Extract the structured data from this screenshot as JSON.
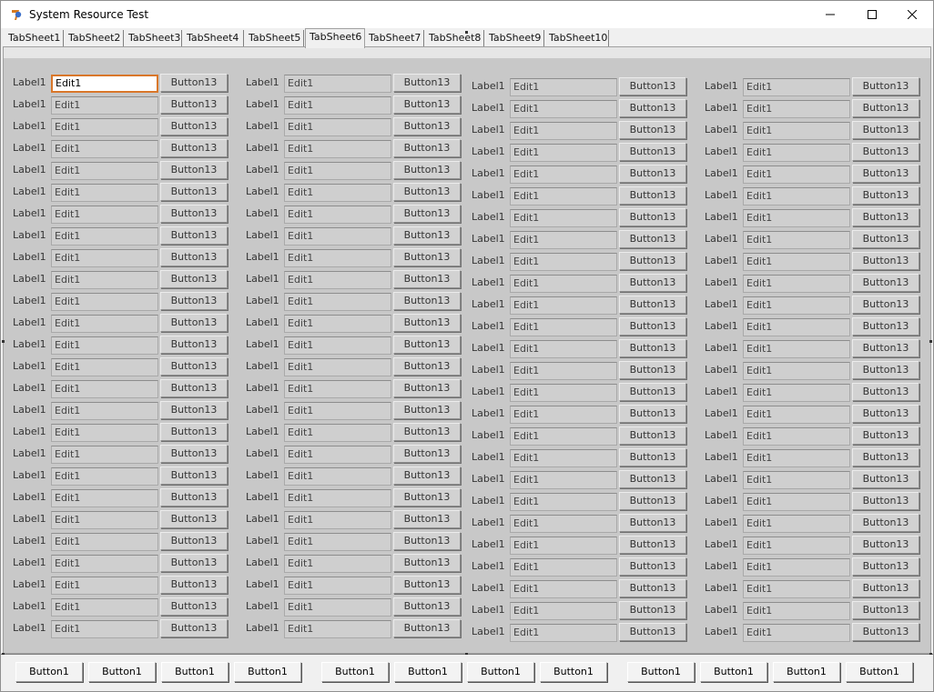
{
  "window": {
    "title": "System Resource Test",
    "icon": "delphi-app-icon"
  },
  "tabs": [
    "TabSheet1",
    "TabSheet2",
    "TabSheet3",
    "TabSheet4",
    "TabSheet5",
    "TabSheet6",
    "TabSheet7",
    "TabSheet8",
    "TabSheet9",
    "TabSheet10"
  ],
  "active_tab": "TabSheet6",
  "row_label": "Label1",
  "row_edit_value": "Edit1",
  "row_button_label": "Button13",
  "rows_per_column": 26,
  "focused_edit": {
    "column": 1,
    "row": 1
  },
  "bottom_button_label": "Button1",
  "bottom_buttons_count": 12,
  "colors": {
    "focus_border": "#d9772a",
    "panel_bg": "#c8c8c8",
    "window_bg": "#f0f0f0"
  }
}
